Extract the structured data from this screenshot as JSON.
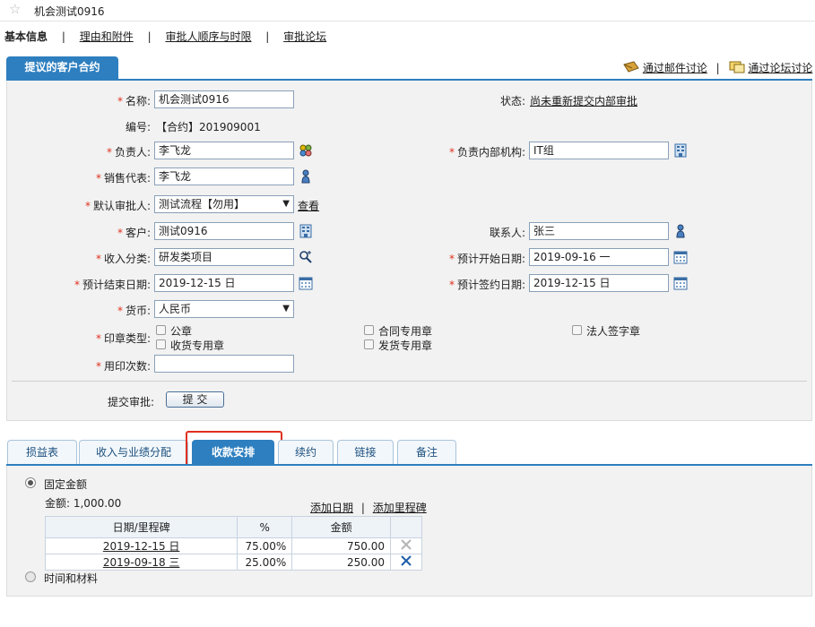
{
  "window": {
    "title": "机会测试0916"
  },
  "top_nav": {
    "items": [
      "基本信息",
      "理由和附件",
      "审批人顺序与时限",
      "审批论坛"
    ],
    "separator": "|"
  },
  "section": {
    "tab_label": "提议的客户合约",
    "email_discuss": "通过邮件讨论",
    "forum_discuss": "通过论坛讨论",
    "separator": "|"
  },
  "form": {
    "name": {
      "label": "名称:",
      "value": "机会测试0916"
    },
    "status": {
      "label": "状态:",
      "value": "尚未重新提交内部审批"
    },
    "number": {
      "label": "编号:",
      "value": "【合约】201909001"
    },
    "owner": {
      "label": "负责人:",
      "value": "李飞龙"
    },
    "owner_org": {
      "label": "负责内部机构:",
      "value": "IT组"
    },
    "sales_rep": {
      "label": "销售代表:",
      "value": "李飞龙"
    },
    "default_approver": {
      "label": "默认审批人:",
      "value": "测试流程【勿用】",
      "view_link": "查看"
    },
    "customer": {
      "label": "客户:",
      "value": "测试0916"
    },
    "contact": {
      "label": "联系人:",
      "value": "张三"
    },
    "income_category": {
      "label": "收入分类:",
      "value": "研发类项目"
    },
    "planned_start": {
      "label": "预计开始日期:",
      "value": "2019-09-16 一"
    },
    "planned_end": {
      "label": "预计结束日期:",
      "value": "2019-12-15 日"
    },
    "planned_sign": {
      "label": "预计签约日期:",
      "value": "2019-12-15 日"
    },
    "currency": {
      "label": "货币:",
      "value": "人民币"
    },
    "seal_type": {
      "label": "印章类型:",
      "options": [
        "公章",
        "合同专用章",
        "法人签字章",
        "收货专用章",
        "发货专用章"
      ]
    },
    "seal_count": {
      "label": "用印次数:",
      "value": ""
    },
    "submit": {
      "label": "提交审批:",
      "button": "提 交"
    }
  },
  "tabs": [
    "损益表",
    "收入与业绩分配",
    "收款安排",
    "续约",
    "链接",
    "备注"
  ],
  "active_tab": "收款安排",
  "payment": {
    "fixed_amount_label": "固定金额",
    "amount_text": "金额: 1,000.00",
    "add_date": "添加日期",
    "add_milestone": "添加里程碑",
    "separator": "|",
    "columns": [
      "日期/里程碑",
      "%",
      "金额"
    ],
    "rows": [
      {
        "date": "2019-12-15 日",
        "percent": "75.00%",
        "amount": "750.00"
      },
      {
        "date": "2019-09-18 三",
        "percent": "25.00%",
        "amount": "250.00"
      }
    ],
    "time_material_label": "时间和材料"
  },
  "colors": {
    "accent": "#2e7fbf",
    "highlight": "#e0301e",
    "required": "#e0301e"
  }
}
